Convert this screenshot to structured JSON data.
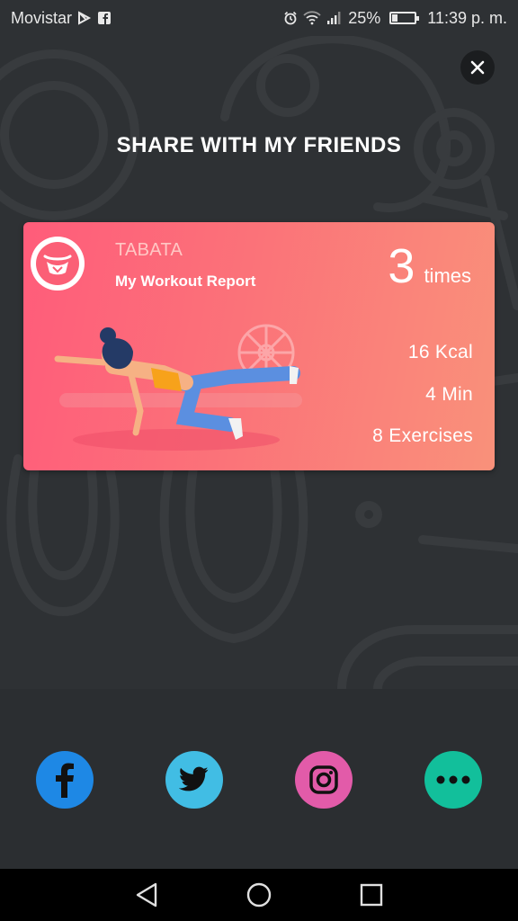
{
  "status_bar": {
    "carrier": "Movistar",
    "battery_percent_text": "25%",
    "battery_level": 0.25,
    "time": "11:39 p. m."
  },
  "share_screen": {
    "title": "SHARE WITH MY FRIENDS",
    "close_icon": "close-icon"
  },
  "card": {
    "app_name": "TABATA",
    "report_title": "My Workout Report",
    "times_value": "3",
    "times_label": "times",
    "kcal": "16 Kcal",
    "minutes": "4 Min",
    "exercises": "8 Exercises",
    "colors": {
      "gradient_start": "#ff5c7a",
      "gradient_end": "#f9917a"
    }
  },
  "share_buttons": [
    {
      "name": "facebook",
      "icon": "facebook-icon",
      "color": "#1e88e5"
    },
    {
      "name": "twitter",
      "icon": "twitter-icon",
      "color": "#41bde4"
    },
    {
      "name": "instagram",
      "icon": "instagram-icon",
      "color": "#e25ba9"
    },
    {
      "name": "more",
      "icon": "more-icon",
      "color": "#12bf9b"
    }
  ],
  "nav_bar": {
    "back_icon": "back-icon",
    "home_icon": "home-icon",
    "recents_icon": "recents-icon"
  }
}
